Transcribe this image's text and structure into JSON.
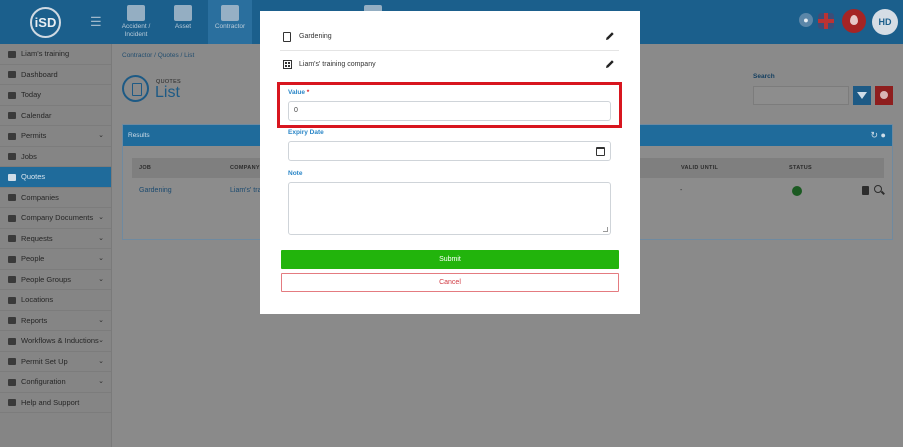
{
  "app": {
    "logo_text": "iSD"
  },
  "topnav": [
    {
      "label": "Accident / Incident",
      "active": false
    },
    {
      "label": "Asset",
      "active": false
    },
    {
      "label": "Contractor",
      "active": true
    }
  ],
  "sidebar": {
    "org": "Liam's training",
    "items": [
      {
        "label": "Dashboard",
        "chevron": false,
        "active": false
      },
      {
        "label": "Today",
        "chevron": false,
        "active": false
      },
      {
        "label": "Calendar",
        "chevron": false,
        "active": false
      },
      {
        "label": "Permits",
        "chevron": true,
        "active": false
      },
      {
        "label": "Jobs",
        "chevron": false,
        "active": false
      },
      {
        "label": "Quotes",
        "chevron": false,
        "active": true
      },
      {
        "label": "Companies",
        "chevron": false,
        "active": false
      },
      {
        "label": "Company Documents",
        "chevron": true,
        "active": false
      },
      {
        "label": "Requests",
        "chevron": true,
        "active": false
      },
      {
        "label": "People",
        "chevron": true,
        "active": false
      },
      {
        "label": "People Groups",
        "chevron": true,
        "active": false
      },
      {
        "label": "Locations",
        "chevron": false,
        "active": false
      },
      {
        "label": "Reports",
        "chevron": true,
        "active": false
      },
      {
        "label": "Workflows & Inductions",
        "chevron": true,
        "active": false
      },
      {
        "label": "Permit Set Up",
        "chevron": true,
        "active": false
      },
      {
        "label": "Configuration",
        "chevron": true,
        "active": false
      },
      {
        "label": "Help and Support",
        "chevron": false,
        "active": false
      }
    ]
  },
  "page": {
    "breadcrumb": "Contractor  /  Quotes  /  List",
    "kicker": "QUOTES",
    "title": "List",
    "search_label": "Search",
    "results_title": "Results"
  },
  "table": {
    "headers": {
      "job": "JOB",
      "company": "COMPANY",
      "valid_until": "VALID UNTIL",
      "status": "STATUS"
    },
    "row": {
      "job": "Gardening",
      "company": "Liam's' tra",
      "valid_until": "-"
    }
  },
  "modal": {
    "job_name": "Gardening",
    "company_name": "Liam's' training company",
    "value_label": "Value",
    "required_mark": "*",
    "value": "0",
    "expiry_label": "Expiry Date",
    "expiry_value": "",
    "note_label": "Note",
    "note_value": "",
    "submit_label": "Submit",
    "cancel_label": "Cancel"
  },
  "user": {
    "initials": "HD"
  },
  "colors": {
    "brand": "#1b5f8c",
    "submit": "#22b40c",
    "cancel": "#d03a42",
    "highlight": "#d8161f",
    "label": "#2a86c7"
  }
}
